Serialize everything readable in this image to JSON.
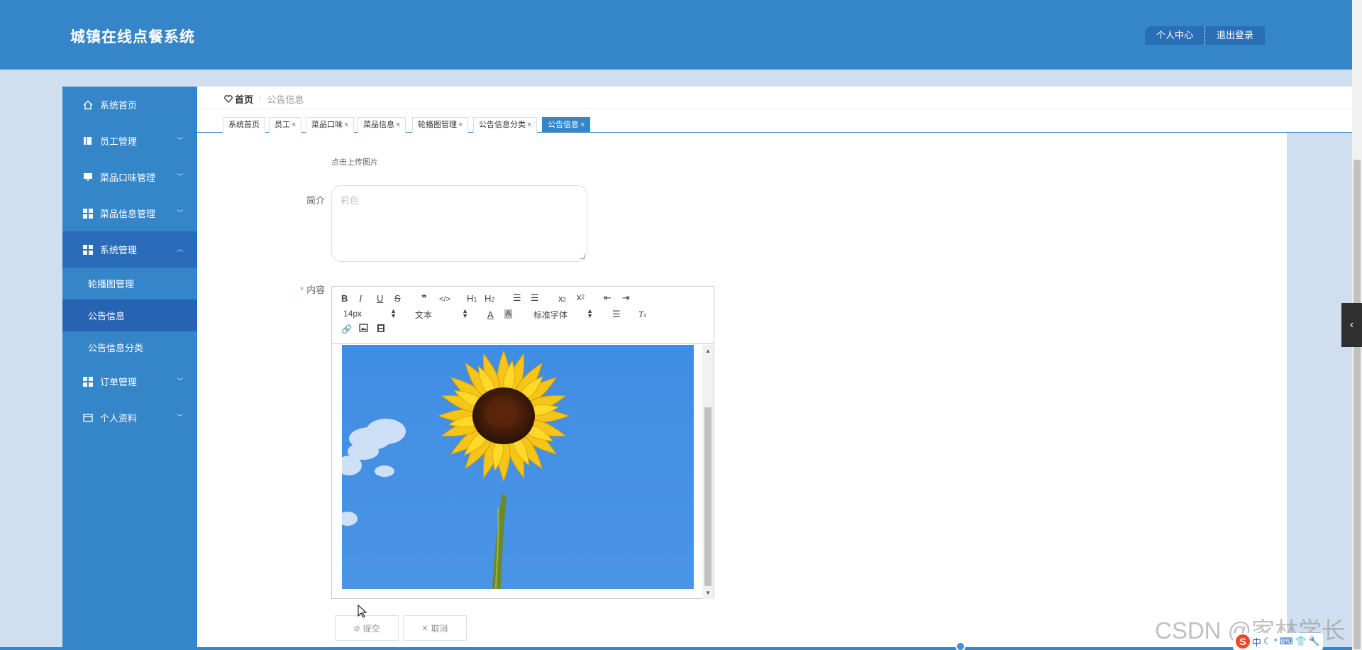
{
  "app": {
    "title": "城镇在线点餐系统"
  },
  "top_nav": {
    "profile_label": "个人中心",
    "logout_label": "退出登录"
  },
  "sidebar": {
    "items": [
      {
        "label": "系统首页"
      },
      {
        "label": "员工管理"
      },
      {
        "label": "菜品口味管理"
      },
      {
        "label": "菜品信息管理"
      },
      {
        "label": "系统管理"
      },
      {
        "label": "订单管理"
      },
      {
        "label": "个人资料"
      }
    ],
    "sub_items": [
      {
        "label": "轮播图管理"
      },
      {
        "label": "公告信息"
      },
      {
        "label": "公告信息分类"
      }
    ]
  },
  "breadcrumb": {
    "home": "首页",
    "current": "公告信息"
  },
  "tabs": [
    {
      "label": "系统首页"
    },
    {
      "label": "员工"
    },
    {
      "label": "菜品口味"
    },
    {
      "label": "菜品信息"
    },
    {
      "label": "轮播图管理"
    },
    {
      "label": "公告信息分类"
    },
    {
      "label": "公告信息"
    }
  ],
  "tab_close": "×",
  "form": {
    "upload_hint": "点击上传图片",
    "intro_label": "简介",
    "intro_value": "彩色",
    "content_label": "内容",
    "required_mark": "*",
    "submit_label": "提交",
    "cancel_label": "取消"
  },
  "editor": {
    "font_size": "14px",
    "header_picker": "文本",
    "font_family": "标准字体"
  },
  "watermark": "CSDN @家林学长",
  "ime": {
    "logo": "S",
    "lang": "中"
  },
  "colors": {
    "primary": "#3585c9",
    "active_sub": "#2763b3",
    "header_btn": "#2a6fb6"
  }
}
